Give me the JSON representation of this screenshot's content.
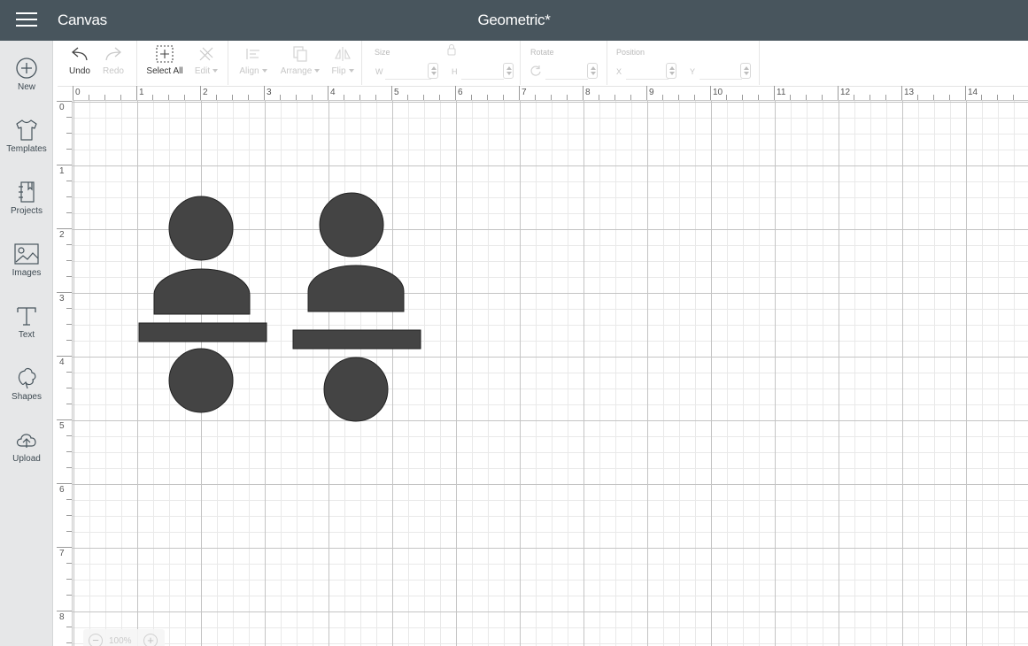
{
  "header": {
    "app_name": "Canvas",
    "doc_title": "Geometric*",
    "background": "#48555d"
  },
  "sidebar": {
    "items": [
      {
        "id": "new",
        "label": "New",
        "icon": "plus-circle-icon"
      },
      {
        "id": "templates",
        "label": "Templates",
        "icon": "tshirt-icon"
      },
      {
        "id": "projects",
        "label": "Projects",
        "icon": "notebook-icon"
      },
      {
        "id": "images",
        "label": "Images",
        "icon": "image-icon"
      },
      {
        "id": "text",
        "label": "Text",
        "icon": "text-t-icon"
      },
      {
        "id": "shapes",
        "label": "Shapes",
        "icon": "shapes-icon"
      },
      {
        "id": "upload",
        "label": "Upload",
        "icon": "cloud-upload-icon"
      }
    ]
  },
  "toolbar": {
    "undo": "Undo",
    "redo": "Redo",
    "select_all": "Select All",
    "edit": "Edit",
    "align": "Align",
    "arrange": "Arrange",
    "flip": "Flip",
    "size": "Size",
    "w": "W",
    "h": "H",
    "rotate": "Rotate",
    "position": "Position",
    "x": "X",
    "y": "Y"
  },
  "ruler": {
    "top": [
      "0",
      "1",
      "2",
      "3",
      "4",
      "5",
      "6",
      "7",
      "8",
      "9",
      "10",
      "11",
      "12",
      "13",
      "14"
    ],
    "left": [
      "0",
      "1",
      "2",
      "3",
      "4",
      "5",
      "6",
      "7",
      "8"
    ]
  },
  "canvas": {
    "shape_color": "#444444",
    "shape_stroke": "#222222"
  },
  "zoom": {
    "level": "100%"
  }
}
